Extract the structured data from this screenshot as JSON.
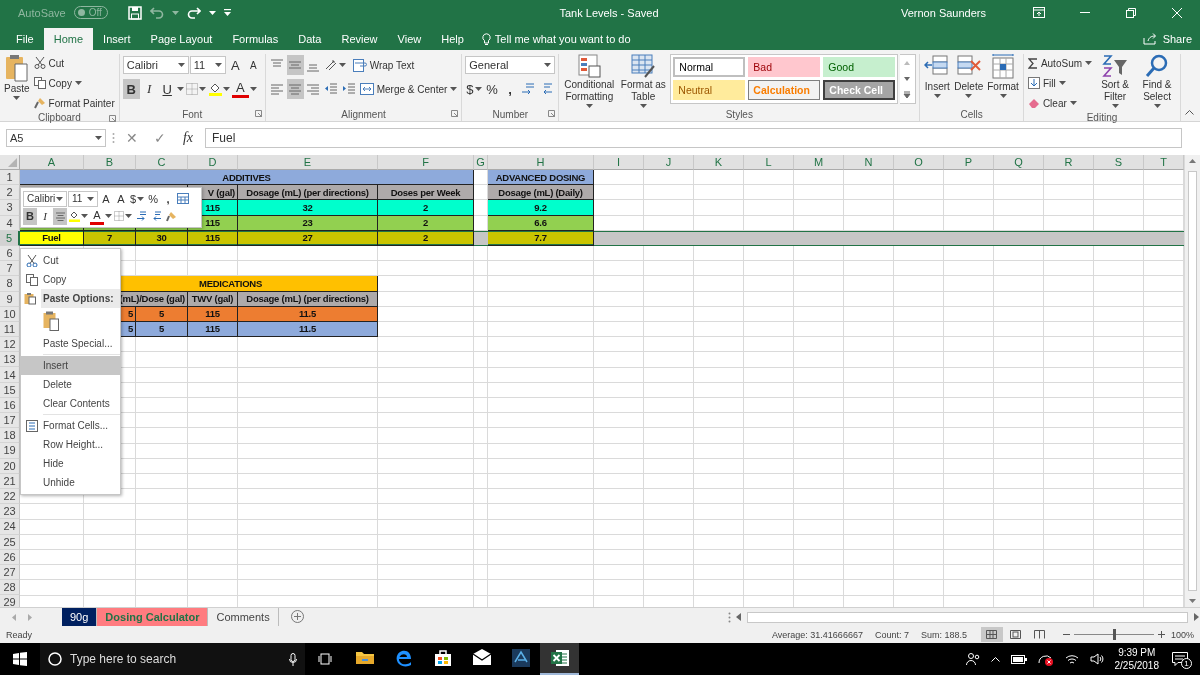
{
  "title_bar": {
    "autosave_label": "AutoSave",
    "autosave_toggle": "Off",
    "autosave_on": false,
    "title": "Tank Levels  -  Saved",
    "user": "Vernon Saunders"
  },
  "tabs": [
    {
      "label": "File",
      "selected": false
    },
    {
      "label": "Home",
      "selected": true
    },
    {
      "label": "Insert",
      "selected": false
    },
    {
      "label": "Page Layout",
      "selected": false
    },
    {
      "label": "Formulas",
      "selected": false
    },
    {
      "label": "Data",
      "selected": false
    },
    {
      "label": "Review",
      "selected": false
    },
    {
      "label": "View",
      "selected": false
    },
    {
      "label": "Help",
      "selected": false
    }
  ],
  "tell_me": "Tell me what you want to do",
  "share": "Share",
  "clipboard": {
    "label": "Clipboard",
    "paste": "Paste",
    "cut": "Cut",
    "copy": "Copy",
    "format_painter": "Format Painter"
  },
  "font": {
    "label": "Font",
    "name": "Calibri",
    "size": "11",
    "grow": "A",
    "shrink": "A",
    "bold": "B",
    "italic": "I",
    "underline": "U",
    "font_color": "A",
    "bold_on": true
  },
  "alignment": {
    "label": "Alignment",
    "wrap_text": "Wrap Text",
    "merge_center": "Merge & Center",
    "buttons": [
      {
        "kind": "top",
        "selected": false
      },
      {
        "kind": "middle",
        "selected": true
      },
      {
        "kind": "bottom",
        "selected": false
      },
      {
        "kind": "left",
        "selected": false
      },
      {
        "kind": "center",
        "selected": true
      },
      {
        "kind": "right",
        "selected": false
      }
    ]
  },
  "number": {
    "label": "Number",
    "format": "General",
    "currency": "$",
    "percent": "%",
    "comma": ","
  },
  "styles": {
    "label": "Styles",
    "conditional_formatting": "Conditional Formatting",
    "format_as_table": "Format as Table",
    "gallery": [
      {
        "label": "Normal",
        "kind": "normal"
      },
      {
        "label": "Bad",
        "kind": "bad"
      },
      {
        "label": "Good",
        "kind": "good"
      },
      {
        "label": "Neutral",
        "kind": "neutral"
      },
      {
        "label": "Calculation",
        "kind": "calculation"
      },
      {
        "label": "Check Cell",
        "kind": "check"
      }
    ]
  },
  "cells": {
    "label": "Cells",
    "insert": "Insert",
    "delete": "Delete",
    "format": "Format"
  },
  "editing": {
    "label": "Editing",
    "autosum": "AutoSum",
    "fill": "Fill",
    "clear": "Clear",
    "sort_filter": "Sort & Filter",
    "find_select": "Find & Select"
  },
  "formula_bar": {
    "name_box": "A5",
    "cancel": "✕",
    "enter": "✓",
    "function": "fx",
    "content": "Fuel"
  },
  "sheet": {
    "columns": [
      "A",
      "B",
      "C",
      "D",
      "E",
      "F",
      "G",
      "H",
      "I",
      "J",
      "K",
      "L",
      "M",
      "N",
      "O",
      "P",
      "Q",
      "R",
      "S",
      "T"
    ],
    "row_numbers": [
      {
        "label": "1",
        "selected": false
      },
      {
        "label": "2",
        "selected": false
      },
      {
        "label": "3",
        "selected": false
      },
      {
        "label": "4",
        "selected": false
      },
      {
        "label": "5",
        "selected": true
      },
      {
        "label": "6",
        "selected": false
      },
      {
        "label": "7",
        "selected": false
      },
      {
        "label": "8",
        "selected": false
      },
      {
        "label": "9",
        "selected": false
      },
      {
        "label": "10",
        "selected": false
      },
      {
        "label": "11",
        "selected": false
      },
      {
        "label": "12",
        "selected": false
      },
      {
        "label": "13",
        "selected": false
      },
      {
        "label": "14",
        "selected": false
      },
      {
        "label": "15",
        "selected": false
      },
      {
        "label": "16",
        "selected": false
      },
      {
        "label": "17",
        "selected": false
      },
      {
        "label": "18",
        "selected": false
      },
      {
        "label": "19",
        "selected": false
      },
      {
        "label": "20",
        "selected": false
      },
      {
        "label": "21",
        "selected": false
      },
      {
        "label": "22",
        "selected": false
      },
      {
        "label": "23",
        "selected": false
      },
      {
        "label": "24",
        "selected": false
      },
      {
        "label": "25",
        "selected": false
      },
      {
        "label": "26",
        "selected": false
      },
      {
        "label": "27",
        "selected": false
      },
      {
        "label": "28",
        "selected": false
      },
      {
        "label": "29",
        "selected": false
      }
    ],
    "additives": {
      "title": "ADDITIVES",
      "headers": [
        "V (gal)",
        "Dosage (mL) (per directions)",
        "Doses per Week"
      ],
      "rows": [
        {
          "color": "#00ffcc",
          "cells": [
            "",
            "",
            "115",
            "32",
            "2"
          ]
        },
        {
          "color": "#92d050",
          "cells": [
            "",
            "",
            "115",
            "23",
            "2"
          ]
        },
        {
          "color": "#c9c400",
          "label": {
            "text": "Fuel",
            "color": "#ffff00"
          },
          "cells": [
            "7",
            "30",
            "115",
            "27",
            "2"
          ]
        }
      ]
    },
    "advanced_dosing": {
      "title": "ADVANCED DOSING",
      "header": "Dosage (mL) (Daily)",
      "values": [
        {
          "text": "9.2",
          "color": "#00ffcc"
        },
        {
          "text": "6.6",
          "color": "#92d050"
        },
        {
          "text": "7.7",
          "color": "#c9c400"
        }
      ]
    },
    "medications": {
      "title": "MEDICATIONS",
      "headers": [
        "(mL)/Dose (gal)",
        "TWV (gal)",
        "Dosage (mL) (per directions)"
      ],
      "rows": [
        {
          "color": "#ed7d31",
          "cells": [
            "5",
            "5",
            "115",
            "11.5"
          ]
        },
        {
          "color": "#8eaadb",
          "cells": [
            "5",
            "5",
            "115",
            "11.5"
          ]
        }
      ]
    }
  },
  "mini_toolbar": {
    "font": "Calibri",
    "size": "11",
    "grow": "A",
    "shrink": "A",
    "currency": "$",
    "percent": "%",
    "comma": ",",
    "bold": "B",
    "italic": "I",
    "font_color": "A",
    "bold_on": true
  },
  "context_menu": [
    {
      "label": "Cut",
      "kind": "cut",
      "selected": false
    },
    {
      "label": "Copy",
      "kind": "copy",
      "selected": false
    },
    {
      "label": "Paste Options:",
      "kind": "header",
      "selected": false
    },
    {
      "kind": "paste",
      "selected": false
    },
    {
      "label": "Paste Special...",
      "kind": "plain",
      "selected": false
    },
    {
      "label": "Insert",
      "kind": "plain",
      "selected": true
    },
    {
      "label": "Delete",
      "kind": "plain",
      "selected": false
    },
    {
      "label": "Clear Contents",
      "kind": "plain",
      "selected": false
    },
    {
      "label": "Format Cells...",
      "kind": "format",
      "selected": false
    },
    {
      "label": "Row Height...",
      "kind": "plain",
      "selected": false
    },
    {
      "label": "Hide",
      "kind": "plain",
      "selected": false
    },
    {
      "label": "Unhide",
      "kind": "plain",
      "selected": false
    }
  ],
  "sheet_tabs": [
    {
      "label": "90g",
      "selected": false,
      "color": "#002060"
    },
    {
      "label": "Dosing Calculator",
      "selected": true,
      "color": "#ff7c80"
    },
    {
      "label": "Comments",
      "selected": false
    }
  ],
  "status_bar": {
    "mode": "Ready",
    "stats": [
      "Average: 31.41666667",
      "Count: 7",
      "Sum: 188.5"
    ],
    "zoom": "100%",
    "zoom_level": {
      "level": 0.5
    }
  },
  "taskbar": {
    "search_placeholder": "Type here to search",
    "apps": [
      {
        "kind": "explorer",
        "selected": false
      },
      {
        "kind": "edge",
        "selected": false
      },
      {
        "kind": "store",
        "selected": false
      },
      {
        "kind": "mail",
        "selected": false
      },
      {
        "kind": "app",
        "selected": false
      },
      {
        "kind": "excel",
        "selected": true
      }
    ],
    "time": "9:39 PM",
    "date": "2/25/2018",
    "notifications": "1"
  }
}
